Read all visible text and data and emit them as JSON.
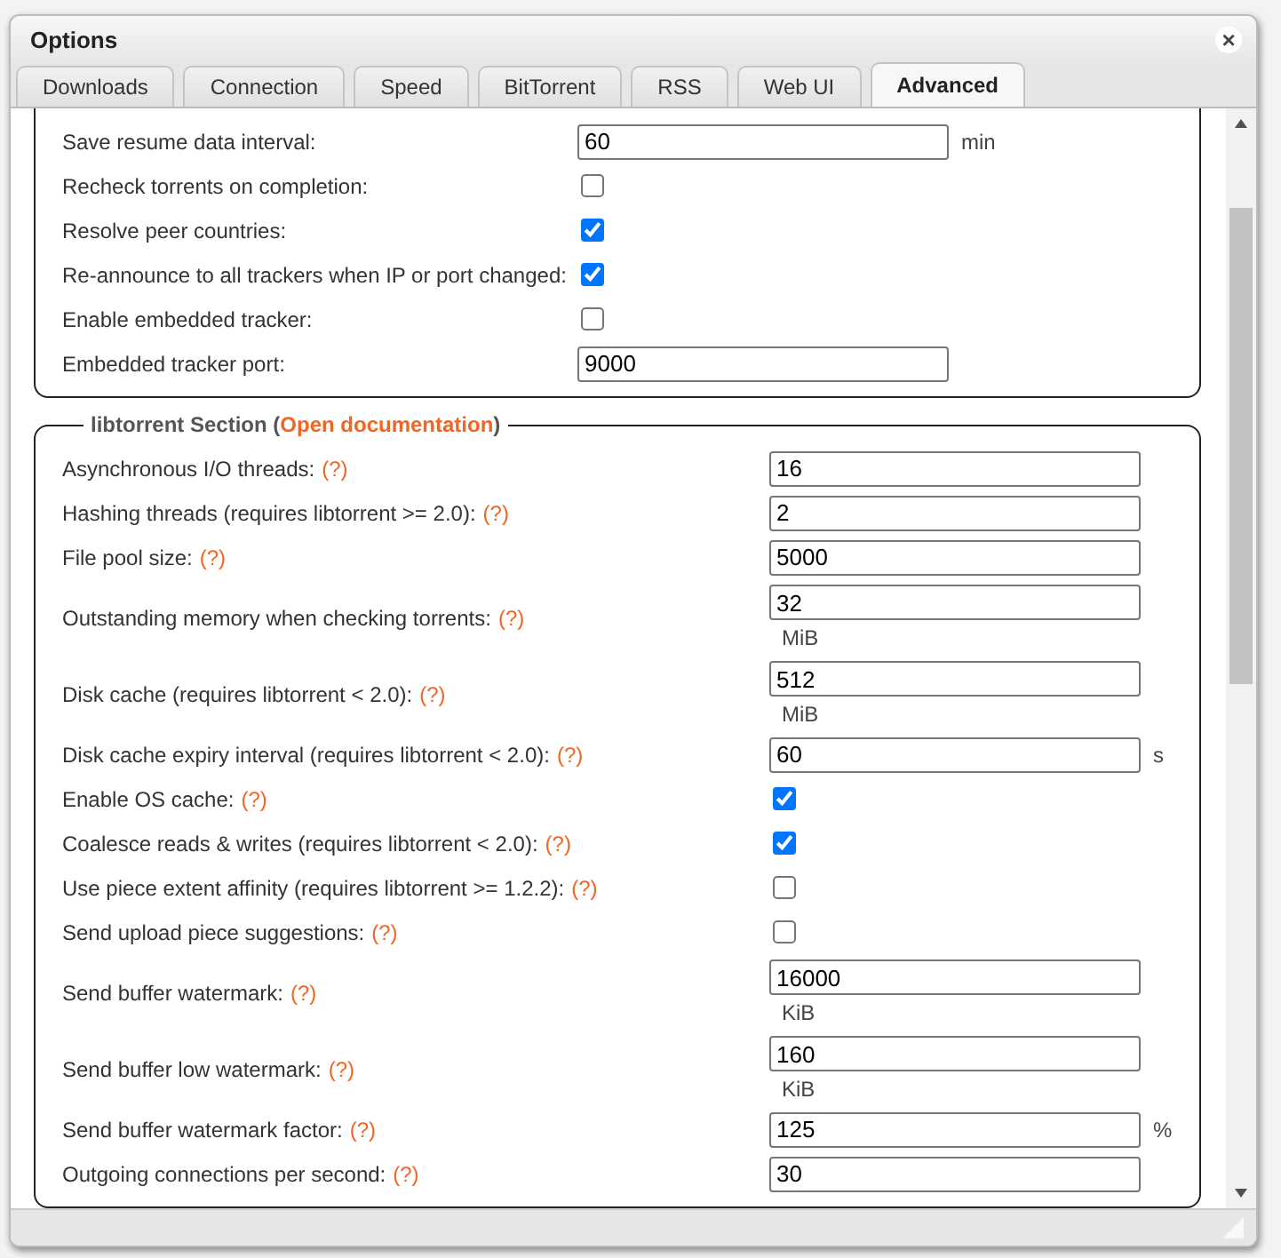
{
  "window": {
    "title": "Options",
    "close": "×"
  },
  "tabs": [
    {
      "label": "Downloads",
      "selected": false
    },
    {
      "label": "Connection",
      "selected": false
    },
    {
      "label": "Speed",
      "selected": false
    },
    {
      "label": "BitTorrent",
      "selected": false
    },
    {
      "label": "RSS",
      "selected": false
    },
    {
      "label": "Web UI",
      "selected": false
    },
    {
      "label": "Advanced",
      "selected": true
    }
  ],
  "sections": [
    {
      "kind": "general",
      "rows": [
        {
          "kind": "input",
          "label": "Save resume data interval:",
          "value": "60",
          "unit": "min",
          "unit_below": false
        },
        {
          "kind": "checkbox",
          "label": "Recheck torrents on completion:",
          "checked": false
        },
        {
          "kind": "checkbox",
          "label": "Resolve peer countries:",
          "checked": true
        },
        {
          "kind": "checkbox",
          "label": "Re-announce to all trackers when IP or port changed:",
          "checked": true
        },
        {
          "kind": "checkbox",
          "label": "Enable embedded tracker:",
          "checked": false
        },
        {
          "kind": "input",
          "label": "Embedded tracker port:",
          "value": "9000"
        }
      ]
    },
    {
      "kind": "libtorrent",
      "legend": {
        "title": "libtorrent Section (",
        "link": "Open documentation",
        "close": ")"
      },
      "rows": [
        {
          "kind": "input",
          "label": "Asynchronous I/O threads:",
          "help": "(?)",
          "value": "16"
        },
        {
          "kind": "input",
          "label": "Hashing threads (requires libtorrent >= 2.0):",
          "help": "(?)",
          "value": "2"
        },
        {
          "kind": "input",
          "label": "File pool size:",
          "help": "(?)",
          "value": "5000"
        },
        {
          "kind": "input",
          "label": "Outstanding memory when checking torrents:",
          "help": "(?)",
          "value": "32",
          "unit": "MiB",
          "unit_below": true
        },
        {
          "kind": "input",
          "label": "Disk cache (requires libtorrent < 2.0):",
          "help": "(?)",
          "value": "512",
          "unit": "MiB",
          "unit_below": true
        },
        {
          "kind": "input",
          "label": "Disk cache expiry interval (requires libtorrent < 2.0):",
          "help": "(?)",
          "value": "60",
          "unit": "s",
          "unit_below": false
        },
        {
          "kind": "checkbox",
          "label": "Enable OS cache:",
          "help": "(?)",
          "checked": true
        },
        {
          "kind": "checkbox",
          "label": "Coalesce reads & writes (requires libtorrent < 2.0):",
          "help": "(?)",
          "checked": true
        },
        {
          "kind": "checkbox",
          "label": "Use piece extent affinity (requires libtorrent >= 1.2.2):",
          "help": "(?)",
          "checked": false
        },
        {
          "kind": "checkbox",
          "label": "Send upload piece suggestions:",
          "help": "(?)",
          "checked": false
        },
        {
          "kind": "input",
          "label": "Send buffer watermark:",
          "help": "(?)",
          "value": "16000",
          "unit": "KiB",
          "unit_below": true
        },
        {
          "kind": "input",
          "label": "Send buffer low watermark:",
          "help": "(?)",
          "value": "160",
          "unit": "KiB",
          "unit_below": true
        },
        {
          "kind": "input",
          "label": "Send buffer watermark factor:",
          "help": "(?)",
          "value": "125",
          "unit": "%",
          "unit_below": false
        },
        {
          "kind": "input",
          "label": "Outgoing connections per second:",
          "help": "(?)",
          "value": "30"
        }
      ]
    }
  ]
}
